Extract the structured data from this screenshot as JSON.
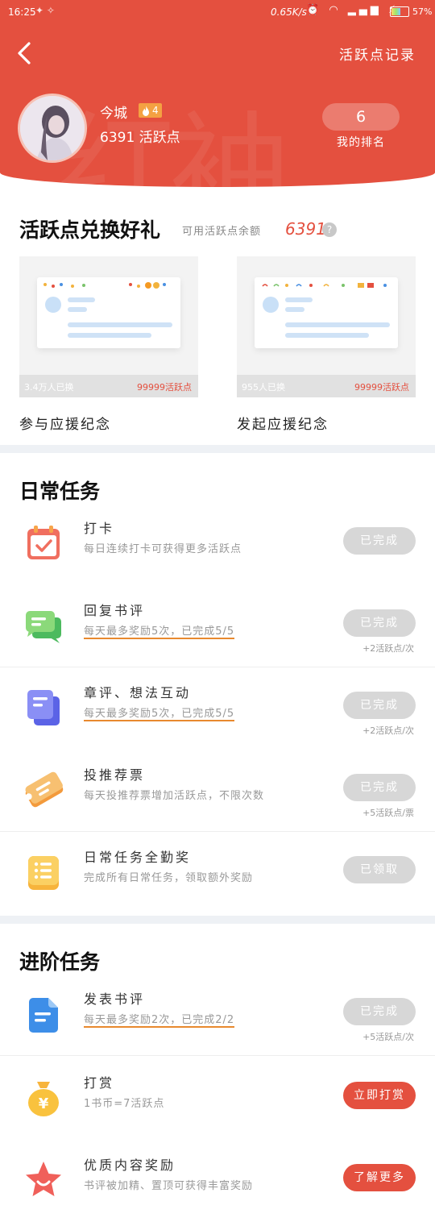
{
  "status_bar": {
    "time": "16:25",
    "speed": "0.65K/s",
    "battery": "57%"
  },
  "header": {
    "record_link": "活跃点记录",
    "username": "今城",
    "level": "4",
    "points_text": "6391 活跃点",
    "rank_value": "6",
    "rank_label": "我的排名",
    "watermark": "红袖"
  },
  "exchange": {
    "title": "活跃点兑换好礼",
    "balance_label": "可用活跃点余额",
    "balance_value": "6391",
    "help": "?",
    "gifts": [
      {
        "name": "参与应援纪念",
        "count": "3.4万人已换",
        "cost": "99999活跃点"
      },
      {
        "name": "发起应援纪念",
        "count": "955人已换",
        "cost": "99999活跃点"
      }
    ]
  },
  "daily": {
    "title": "日常任务",
    "tasks": [
      {
        "icon": "calendar-check-icon",
        "name": "打卡",
        "desc": "每日连续打卡可获得更多活跃点",
        "button": "已完成",
        "reward": ""
      },
      {
        "icon": "chat-bubbles-icon",
        "name": "回复书评",
        "desc": "每天最多奖励5次，已完成5/5",
        "button": "已完成",
        "reward": "+2活跃点/次"
      },
      {
        "icon": "notes-stack-icon",
        "name": "章评、想法互动",
        "desc": "每天最多奖励5次，已完成5/5",
        "button": "已完成",
        "reward": "+2活跃点/次"
      },
      {
        "icon": "ticket-icon",
        "name": "投推荐票",
        "desc": "每天投推荐票增加活跃点，不限次数",
        "button": "已完成",
        "reward": "+5活跃点/票"
      },
      {
        "icon": "list-icon",
        "name": "日常任务全勤奖",
        "desc": "完成所有日常任务，领取额外奖励",
        "button": "已领取",
        "reward": ""
      }
    ]
  },
  "advanced": {
    "title": "进阶任务",
    "tasks": [
      {
        "icon": "document-icon",
        "name": "发表书评",
        "desc": "每天最多奖励2次，已完成2/2",
        "button": "已完成",
        "reward": "+5活跃点/次"
      },
      {
        "icon": "money-bag-icon",
        "name": "打赏",
        "desc": "1书币=7活跃点",
        "button": "立即打赏",
        "reward": ""
      },
      {
        "icon": "star-icon",
        "name": "优质内容奖励",
        "desc": "书评被加精、置顶可获得丰富奖励",
        "button": "了解更多",
        "reward": ""
      }
    ]
  },
  "colors": {
    "primary": "#e4503f",
    "disabled": "#d7d7d7",
    "underline": "#e8892e"
  }
}
